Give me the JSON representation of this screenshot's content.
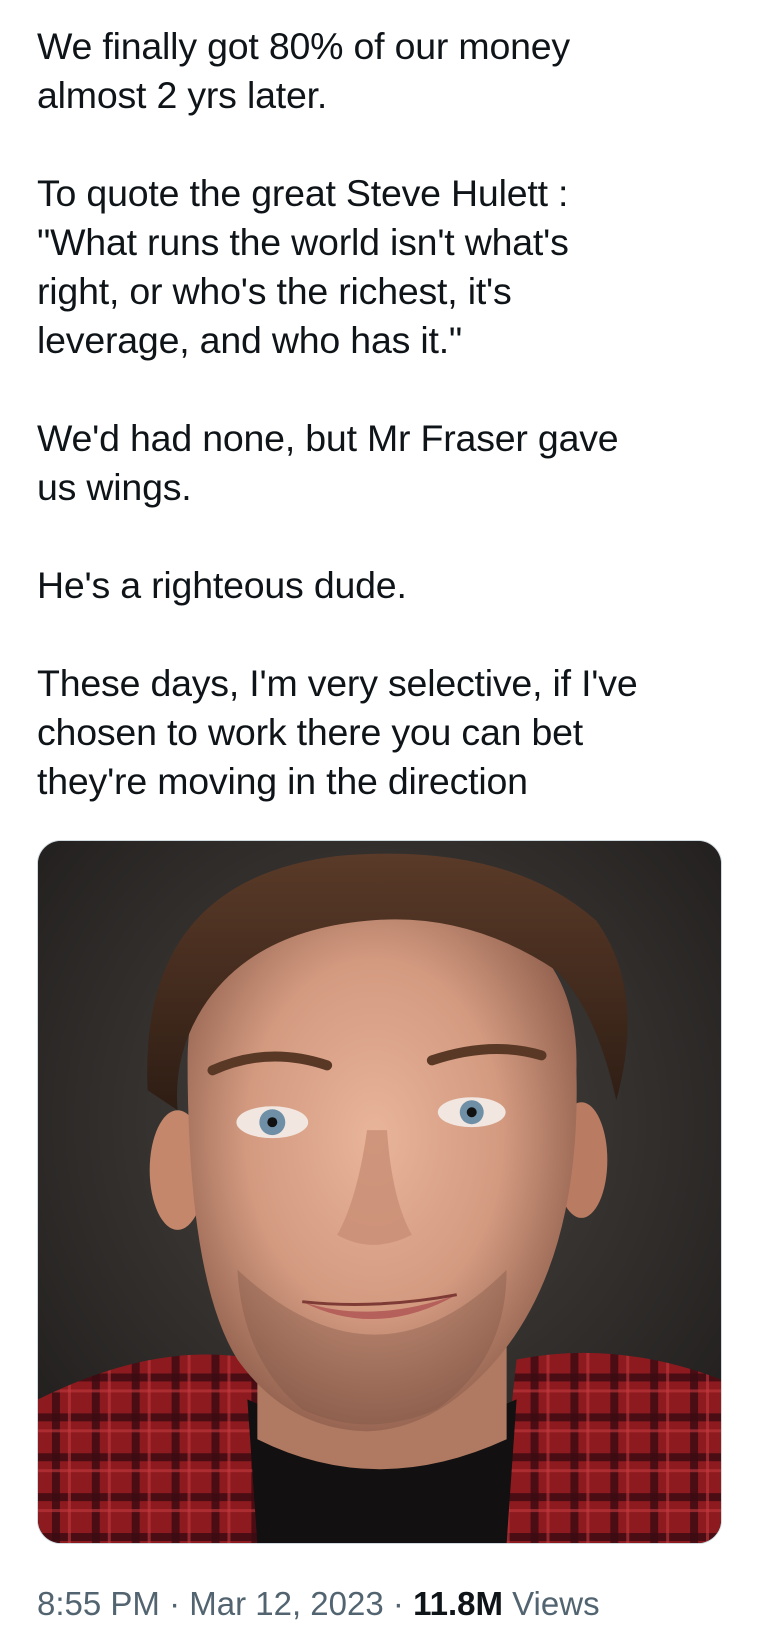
{
  "tweet": {
    "paragraphs": [
      {
        "lines": [
          "We finally got 80% of our money",
          "almost 2 yrs later."
        ]
      },
      {
        "lines": [
          "To quote the great Steve Hulett :",
          "\"What runs the world isn't what's",
          "right, or who's the richest, it's",
          "leverage, and who has it.\""
        ]
      },
      {
        "lines": [
          "We'd had none, but Mr Fraser gave",
          "us wings."
        ]
      },
      {
        "lines": [
          "He's a righteous dude."
        ]
      },
      {
        "lines": [
          "These days, I'm very selective, if I've",
          "chosen to work there you can bet",
          "they're moving in the direction"
        ]
      }
    ],
    "media": {
      "type": "photo",
      "description_icon": "portrait-photo"
    },
    "meta": {
      "time": "8:55 PM",
      "separator": "·",
      "date": "Mar 12, 2023",
      "views_count": "11.8M",
      "views_label": "Views"
    }
  },
  "colors": {
    "text": "#0f1419",
    "secondary": "#536471",
    "border": "#cfd9de"
  }
}
